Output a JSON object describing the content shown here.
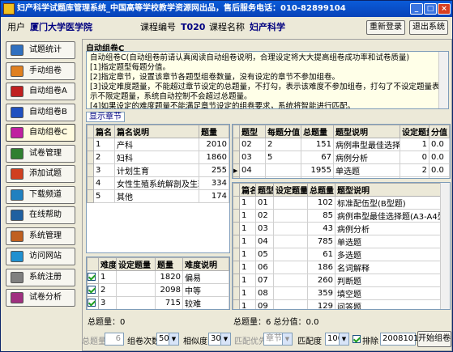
{
  "window": {
    "title": "妇产科学试题库管理系统_中国高等学校教学资源网出品，售后服务电话：010-82899104",
    "minimize": "_",
    "maximize": "□",
    "close": "×"
  },
  "info": {
    "user_label": "用户",
    "user_value": "厦门大学医学院",
    "course_code_label": "课程编号",
    "course_code_value": "T020",
    "course_name_label": "课程名称",
    "course_name_value": "妇产科学",
    "relogin": "重新登录",
    "exit": "退出系统"
  },
  "sidebar": [
    {
      "label": "试题统计",
      "icon": "chart-icon",
      "color": "#3070c0"
    },
    {
      "label": "手动组卷",
      "icon": "hand-icon",
      "color": "#e08020"
    },
    {
      "label": "自动组卷A",
      "icon": "auto-a-icon",
      "color": "#c02020"
    },
    {
      "label": "自动组卷B",
      "icon": "auto-b-icon",
      "color": "#2050c0"
    },
    {
      "label": "自动组卷C",
      "icon": "auto-c-icon",
      "color": "#c020a0"
    },
    {
      "label": "试卷管理",
      "icon": "paper-icon",
      "color": "#308030"
    },
    {
      "label": "添加试题",
      "icon": "add-icon",
      "color": "#d04020"
    },
    {
      "label": "下载频道",
      "icon": "download-icon",
      "color": "#2080c0"
    },
    {
      "label": "在线帮助",
      "icon": "help-icon",
      "color": "#2060a0"
    },
    {
      "label": "系统管理",
      "icon": "settings-icon",
      "color": "#c06020"
    },
    {
      "label": "访问网站",
      "icon": "globe-icon",
      "color": "#2090d0"
    },
    {
      "label": "系统注册",
      "icon": "register-icon",
      "color": "#808080"
    },
    {
      "label": "试卷分析",
      "icon": "analysis-icon",
      "color": "#a03080"
    }
  ],
  "main": {
    "group_title": "自动组卷C",
    "description": [
      "自动组卷C(自动组卷前请认真阅读自动组卷说明，合理设定将大大提高组卷成功率和试卷质量)",
      "[1]指定题型每题分值。",
      "[2]指定章节，设置该章节各题型组卷数量，没有设定的章节不参加组卷。",
      "[3]设定难度题量，不能超过章节设定的总题量，不打勾，表示该难度不参加组卷，打勾了不设定题量表示不限定题量，系统自动控制不会超过总题量。",
      "[4]如果设定的难度题量不能满足章节设定的组卷要求，系统将智能进行匹配。"
    ],
    "show_chapters": "显示章节",
    "chapters": {
      "headers": [
        "篇名",
        "篇名说明",
        "题量"
      ],
      "rows": [
        [
          "1",
          "产科",
          "2010"
        ],
        [
          "2",
          "妇科",
          "1860"
        ],
        [
          "3",
          "计划生育",
          "255"
        ],
        [
          "4",
          "女性生殖系统解剖及生理",
          "334"
        ],
        [
          "5",
          "其他",
          "174"
        ]
      ]
    },
    "difficulty": {
      "headers": [
        "难度",
        "设定题量",
        "题量",
        "难度说明"
      ],
      "rows": [
        [
          "1",
          "",
          "1820",
          "偏易"
        ],
        [
          "2",
          "",
          "2098",
          "中等"
        ],
        [
          "3",
          "",
          "715",
          "较难"
        ]
      ]
    },
    "qtypes": {
      "headers": [
        "题型",
        "每题分值",
        "总题量",
        "题型说明",
        "设定题量",
        "分值"
      ],
      "rows": [
        [
          "02",
          "2",
          "151",
          "病例串型最佳选择题",
          "1",
          "0.0"
        ],
        [
          "03",
          "5",
          "67",
          "病例分析",
          "0",
          "0.0"
        ],
        [
          "04",
          "",
          "1955",
          "单选题",
          "2",
          "0.0"
        ],
        [
          "05",
          "",
          "241",
          "多选题",
          "1",
          "0.0"
        ]
      ]
    },
    "detail": {
      "headers": [
        "篇名",
        "题型",
        "设定题量",
        "总题量",
        "题型说明"
      ],
      "rows": [
        [
          "1",
          "01",
          "",
          "102",
          "标准配伍型(B型题)"
        ],
        [
          "1",
          "02",
          "",
          "85",
          "病例串型最佳选择题(A3-A4型题)"
        ],
        [
          "1",
          "03",
          "",
          "43",
          "病例分析"
        ],
        [
          "1",
          "04",
          "",
          "785",
          "单选题"
        ],
        [
          "1",
          "05",
          "",
          "61",
          "多选题"
        ],
        [
          "1",
          "06",
          "",
          "186",
          "名词解释"
        ],
        [
          "1",
          "07",
          "",
          "260",
          "判断题"
        ],
        [
          "1",
          "08",
          "",
          "359",
          "填空题"
        ],
        [
          "1",
          "09",
          "",
          "129",
          "问答题"
        ],
        [
          "2",
          "01",
          "",
          "86",
          "标准配伍型(B型题)"
        ],
        [
          "2",
          "02",
          "",
          "43",
          "病例串型最佳选择题(A3-A4型题)"
        ]
      ]
    },
    "left_total": "总题量：0",
    "right_total": "总题量：6  总分值：0.0"
  },
  "bottom": {
    "total_label": "总题量",
    "total_value": "6",
    "times_label": "组卷次数",
    "times_value": "50",
    "similar_label": "相似度",
    "similar_value": "30",
    "match_priority_label": "匹配优先",
    "match_priority_value": "章节",
    "match_degree_label": "匹配度",
    "match_degree_value": "100",
    "exclude_label": "排除",
    "exclude_date": "20081016",
    "start_button": "开始组卷"
  }
}
